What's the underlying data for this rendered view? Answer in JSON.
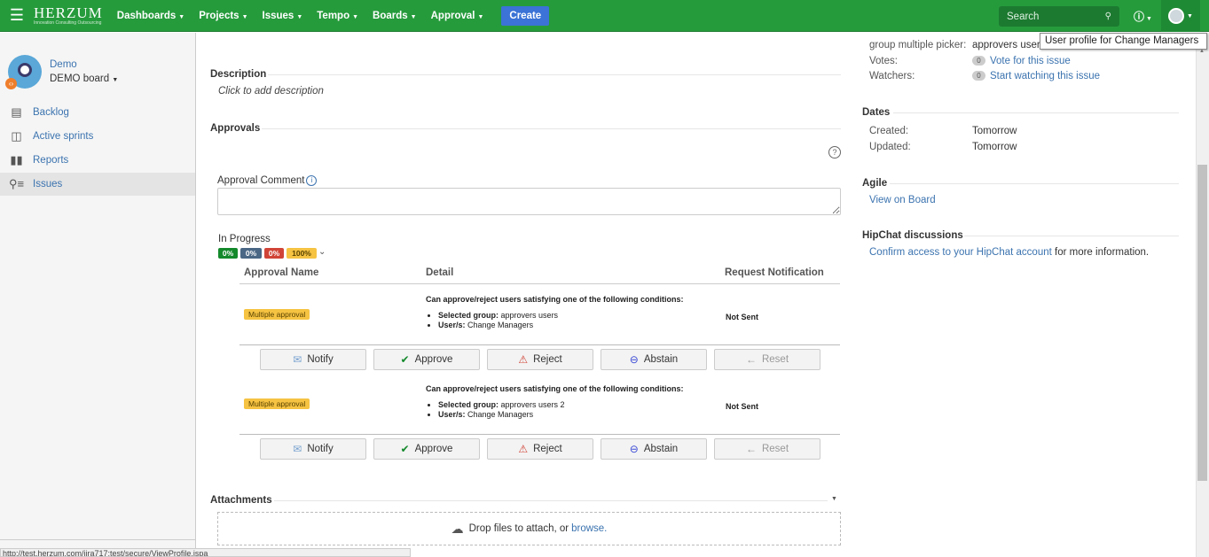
{
  "nav": {
    "logo_name": "HERZUM",
    "logo_tagline": "Innovation Consulting Outsourcing",
    "items": [
      "Dashboards",
      "Projects",
      "Issues",
      "Tempo",
      "Boards",
      "Approval"
    ],
    "create": "Create",
    "search_placeholder": "Search",
    "tooltip": "User profile for Change Managers",
    "brand_color": "#269b3c"
  },
  "sidebar": {
    "project_name": "Demo",
    "board_name": "DEMO board",
    "items": [
      {
        "label": "Backlog",
        "icon": "backlog-icon"
      },
      {
        "label": "Active sprints",
        "icon": "active-sprints-icon"
      },
      {
        "label": "Reports",
        "icon": "reports-icon"
      },
      {
        "label": "Issues",
        "icon": "issues-icon"
      }
    ],
    "status_url": "http://test.herzum.com/jira717:test/secure/ViewProfile.jspa"
  },
  "main": {
    "description_title": "Description",
    "description_placeholder": "Click to add description",
    "approvals_title": "Approvals",
    "comment_label": "Approval Comment",
    "status": "In Progress",
    "percents": [
      {
        "label": "0%",
        "color": "#14892c"
      },
      {
        "label": "0%",
        "color": "#4a6785"
      },
      {
        "label": "0%",
        "color": "#d04437"
      },
      {
        "label": "100%",
        "color": "#f6c342"
      }
    ],
    "columns": [
      "Approval Name",
      "Detail",
      "Request Notification"
    ],
    "rows": [
      {
        "name": "Multiple approval",
        "condition": "Can approve/reject users satisfying one of the following conditions:",
        "group_label": "Selected group:",
        "group_value": "approvers users",
        "users_label": "User/s:",
        "users_value": "Change Managers",
        "notification": "Not Sent"
      },
      {
        "name": "Multiple approval",
        "condition": "Can approve/reject users satisfying one of the following conditions:",
        "group_label": "Selected group:",
        "group_value": "approvers users 2",
        "users_label": "User/s:",
        "users_value": "Change Managers",
        "notification": "Not Sent"
      }
    ],
    "buttons": {
      "notify": "Notify",
      "approve": "Approve",
      "reject": "Reject",
      "abstain": "Abstain",
      "reset": "Reset"
    },
    "attachments_title": "Attachments",
    "drop_text": "Drop files to attach, or",
    "browse": "browse."
  },
  "right": {
    "cut_key": "group multiple picker:",
    "cut_value": "approvers users",
    "votes_key": "Votes:",
    "votes_count": "0",
    "votes_link": "Vote for this issue",
    "watchers_key": "Watchers:",
    "watchers_count": "0",
    "watchers_link": "Start watching this issue",
    "dates_title": "Dates",
    "created_key": "Created:",
    "created_val": "Tomorrow",
    "updated_key": "Updated:",
    "updated_val": "Tomorrow",
    "agile_title": "Agile",
    "agile_link": "View on Board",
    "hipchat_title": "HipChat discussions",
    "hipchat_link": "Confirm access to your HipChat account",
    "hipchat_rest": "for more information."
  }
}
